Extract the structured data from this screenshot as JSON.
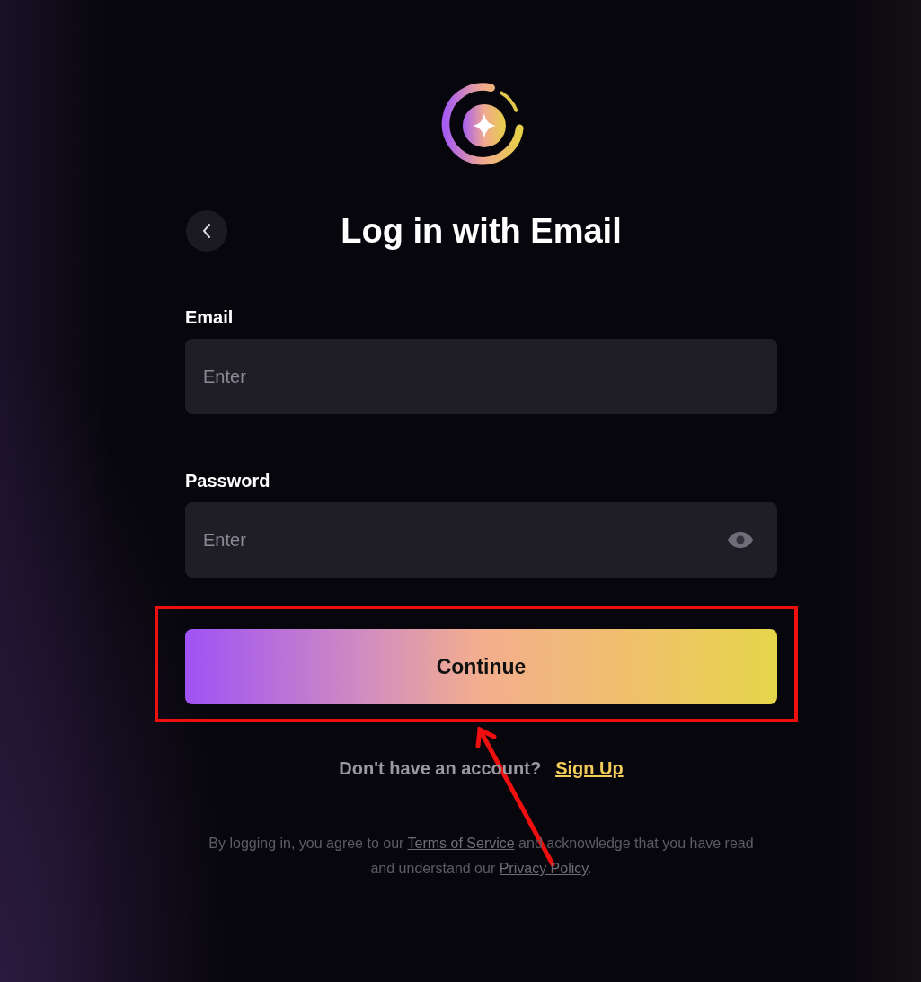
{
  "title": "Log in with Email",
  "fields": [
    {
      "label": "Email",
      "placeholder": "Enter",
      "kind": "text"
    },
    {
      "label": "Password",
      "placeholder": "Enter",
      "kind": "password"
    }
  ],
  "submit": "Continue",
  "signup": {
    "prompt": "Don't have an account?",
    "link": "Sign Up"
  },
  "legal": {
    "before": "By logging in, you agree to our ",
    "terms": "Terms of Service",
    "middle": " and acknowledge that you have read and understand our ",
    "privacy": "Privacy Policy",
    "after": "."
  }
}
